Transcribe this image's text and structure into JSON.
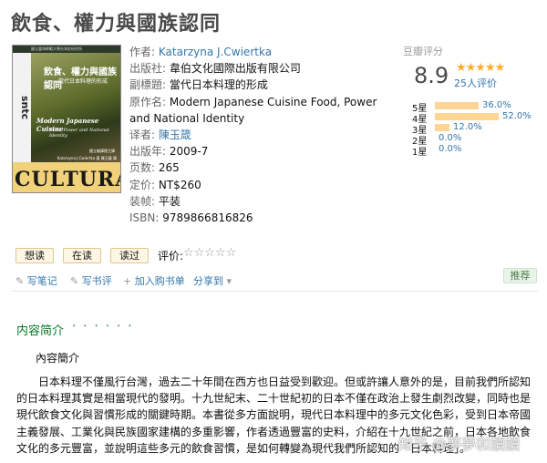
{
  "book": {
    "title": "飲食、權力與國族認同",
    "cover": {
      "top_band": "國立臺灣師範大學台灣史研究所",
      "spine": "sntc",
      "title": "飲食、權力與國族認同",
      "subtitle1": "當代日本料理的形成",
      "subtitle2": "",
      "english_title": "Modern Japanese Cuisine",
      "english_subtitle": "Food, Power and National Identity",
      "credit1": "國立編譯館主譯",
      "credit2": "Katarzyna J.Cwiertka 著 陳玉箴 譯",
      "word": "CULTURAL"
    },
    "info": {
      "author_label": "作者:",
      "author": "Katarzyna J.Cwiertka",
      "publisher_label": "出版社:",
      "publisher": "韋伯文化國際出版有限公司",
      "subtitle_label": "副標題:",
      "subtitle": "當代日本料理的形成",
      "original_label": "原作名:",
      "original_title": "Modern Japanese Cuisine Food, Power and National Identity",
      "translator_label": "译者:",
      "translator": "陳玉箴",
      "year_label": "出版年:",
      "year": "2009-7",
      "pages_label": "页数:",
      "pages": "265",
      "price_label": "定价:",
      "price": "NT$260",
      "binding_label": "装帧:",
      "binding": "平装",
      "isbn_label": "ISBN:",
      "isbn": "9789866816826"
    }
  },
  "rating": {
    "title": "豆瓣评分",
    "score": "8.9",
    "stars": "★★★★★",
    "count": "25人评价",
    "rows": [
      {
        "label": "5星",
        "percent": 36.0,
        "text": "36.0%"
      },
      {
        "label": "4星",
        "percent": 52.0,
        "text": "52.0%"
      },
      {
        "label": "3星",
        "percent": 12.0,
        "text": "12.0%"
      },
      {
        "label": "2星",
        "percent": 0.0,
        "text": "0.0%"
      },
      {
        "label": "1星",
        "percent": 0.0,
        "text": "0.0%"
      }
    ]
  },
  "actions": {
    "want": "想读",
    "reading": "在读",
    "read": "读过",
    "eval_label": "评价:",
    "eval_stars": "☆☆☆☆☆",
    "write_note": "写笔记",
    "write_review": "写书评",
    "add_list": "加入购书单",
    "share": "分享到",
    "recommend": "推荐"
  },
  "intro": {
    "section_title": "内容简介",
    "dots": "· · · · · ·",
    "head": "內容簡介",
    "body": "日本料理不僅風行台灣，過去二十年間在西方也日益受到歡迎。但或許讓人意外的是，目前我們所認知的日本料理其實是相當現代的發明。十九世紀末、二十世紀初的日本不僅在政治上發生劇烈改變，同時也是現代飲食文化與習慣形成的關鍵時期。本書從多方面說明，現代日本料理中的多元文化色彩，受到日本帝國主義發展、工業化與民族國家建構的多重影響，作者透過豐富的史料，介紹在十九世紀之前，日本各地飲食文化的多元豐富，並說明這些多元的飲食習慣，是如何轉變為現代我們所認知的「日本料理」。"
  },
  "watermark": "知乎 @夢夢和讀讀"
}
